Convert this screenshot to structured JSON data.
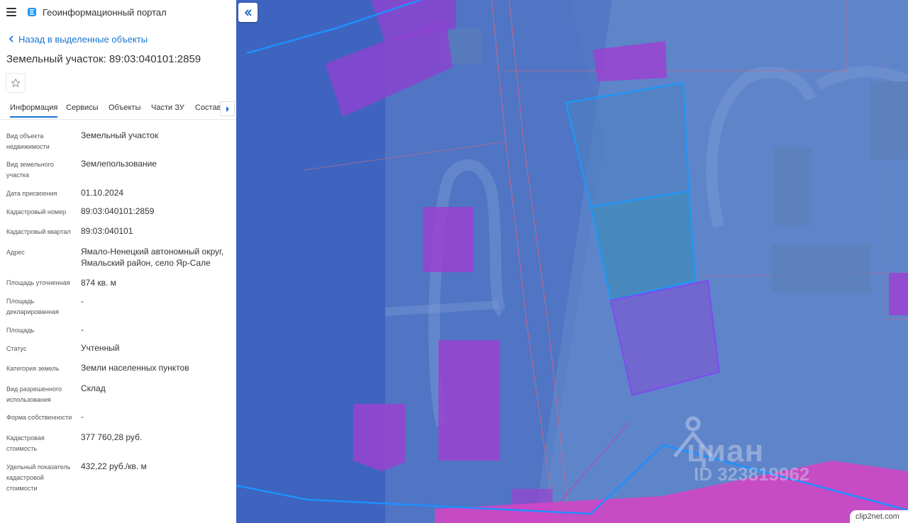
{
  "header": {
    "app_title": "Геоинформационный портал",
    "menu_icon": "menu-icon",
    "logo_icon": "portal-logo-icon"
  },
  "nav": {
    "back_label": "Назад в выделенные объекты"
  },
  "object": {
    "title": "Земельный участок: 89:03:040101:2859"
  },
  "tabs": [
    {
      "label": "Информация",
      "active": true
    },
    {
      "label": "Сервисы"
    },
    {
      "label": "Объекты"
    },
    {
      "label": "Части ЗУ"
    },
    {
      "label": "Состав"
    }
  ],
  "fields": [
    {
      "label": "Вид объекта недвижимости",
      "value": "Земельный участок"
    },
    {
      "label": "Вид земельного участка",
      "value": "Землепользование"
    },
    {
      "label": "Дата присвоения",
      "value": "01.10.2024"
    },
    {
      "label": "Кадастровый номер",
      "value": "89:03:040101:2859"
    },
    {
      "label": "Кадастровый квартал",
      "value": "89:03:040101"
    },
    {
      "label": "Адрес",
      "value": "Ямало-Ненецкий автономный округ, Ямальский район, село Яр-Сале"
    },
    {
      "label": "Площадь уточненная",
      "value": "874 кв. м"
    },
    {
      "label": "Площадь декларированная",
      "value": "-"
    },
    {
      "label": "Площадь",
      "value": "-"
    },
    {
      "label": "Статус",
      "value": "Учтенный"
    },
    {
      "label": "Категория земель",
      "value": "Земли населенных пунктов"
    },
    {
      "label": "Вид разрешенного использования",
      "value": "Склад"
    },
    {
      "label": "Форма собственности",
      "value": "-"
    },
    {
      "label": "Кадастровая стоимость",
      "value": "377 760,28 руб."
    },
    {
      "label": "Удельный показатель кадастровой стоимости",
      "value": "432,22 руб./кв. м"
    }
  ],
  "map": {
    "watermark_brand": "циан",
    "watermark_id": "ID 323819962",
    "badge_text": "clip2net.com",
    "colors": {
      "base": "#4a71c4",
      "parcel_outline": "#1e90ff",
      "building_fill": "#9b3fd6",
      "road_fill": "#d63fb0"
    }
  }
}
